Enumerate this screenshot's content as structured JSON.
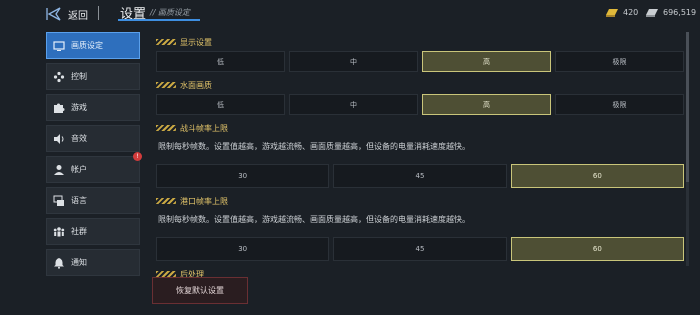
{
  "header": {
    "back_label": "返回",
    "title": "设置",
    "subtitle": "// 画质设定",
    "currency": [
      {
        "icon": "gold-bar-icon",
        "value": "420",
        "color": "#e0b83a"
      },
      {
        "icon": "silver-bar-icon",
        "value": "696,519",
        "color": "#c8ccd0"
      }
    ]
  },
  "sidebar": {
    "items": [
      {
        "name": "sidebar-item-graphics",
        "icon": "monitor-icon",
        "label": "画质设定",
        "active": true
      },
      {
        "name": "sidebar-item-controls",
        "icon": "gamepad-icon",
        "label": "控制"
      },
      {
        "name": "sidebar-item-game",
        "icon": "puzzle-icon",
        "label": "游戏"
      },
      {
        "name": "sidebar-item-audio",
        "icon": "speaker-icon",
        "label": "音效"
      },
      {
        "name": "sidebar-item-account",
        "icon": "user-icon",
        "label": "帐户",
        "badge": "!"
      },
      {
        "name": "sidebar-item-language",
        "icon": "language-icon",
        "label": "语言"
      },
      {
        "name": "sidebar-item-community",
        "icon": "community-icon",
        "label": "社群"
      },
      {
        "name": "sidebar-item-notify",
        "icon": "bell-icon",
        "label": "通知"
      }
    ]
  },
  "sections": {
    "display": {
      "title": "显示设置",
      "options": [
        "低",
        "中",
        "高",
        "极限"
      ],
      "selected": 2
    },
    "water": {
      "title": "水面画质",
      "options": [
        "低",
        "中",
        "高",
        "极限"
      ],
      "selected": 2
    },
    "battle_fps": {
      "title": "战斗帧率上限",
      "desc": "限制每秒帧数。设置值越高，游戏越流畅、画面质量越高，但设备的电量消耗速度越快。",
      "options": [
        "30",
        "45",
        "60"
      ],
      "selected": 2
    },
    "port_fps": {
      "title": "港口帧率上限",
      "desc": "限制每秒帧数。设置值越高，游戏越流畅、画面质量越高，但设备的电量消耗速度越快。",
      "options": [
        "30",
        "45",
        "60"
      ],
      "selected": 2
    },
    "post": {
      "title": "后处理"
    }
  },
  "footer": {
    "reset_label": "恢复默认设置"
  },
  "colors": {
    "accent_blue": "#2e6fbd",
    "accent_gold": "#e3c56a",
    "selected_bg": "#4e4f34",
    "danger": "#d23c3c"
  }
}
